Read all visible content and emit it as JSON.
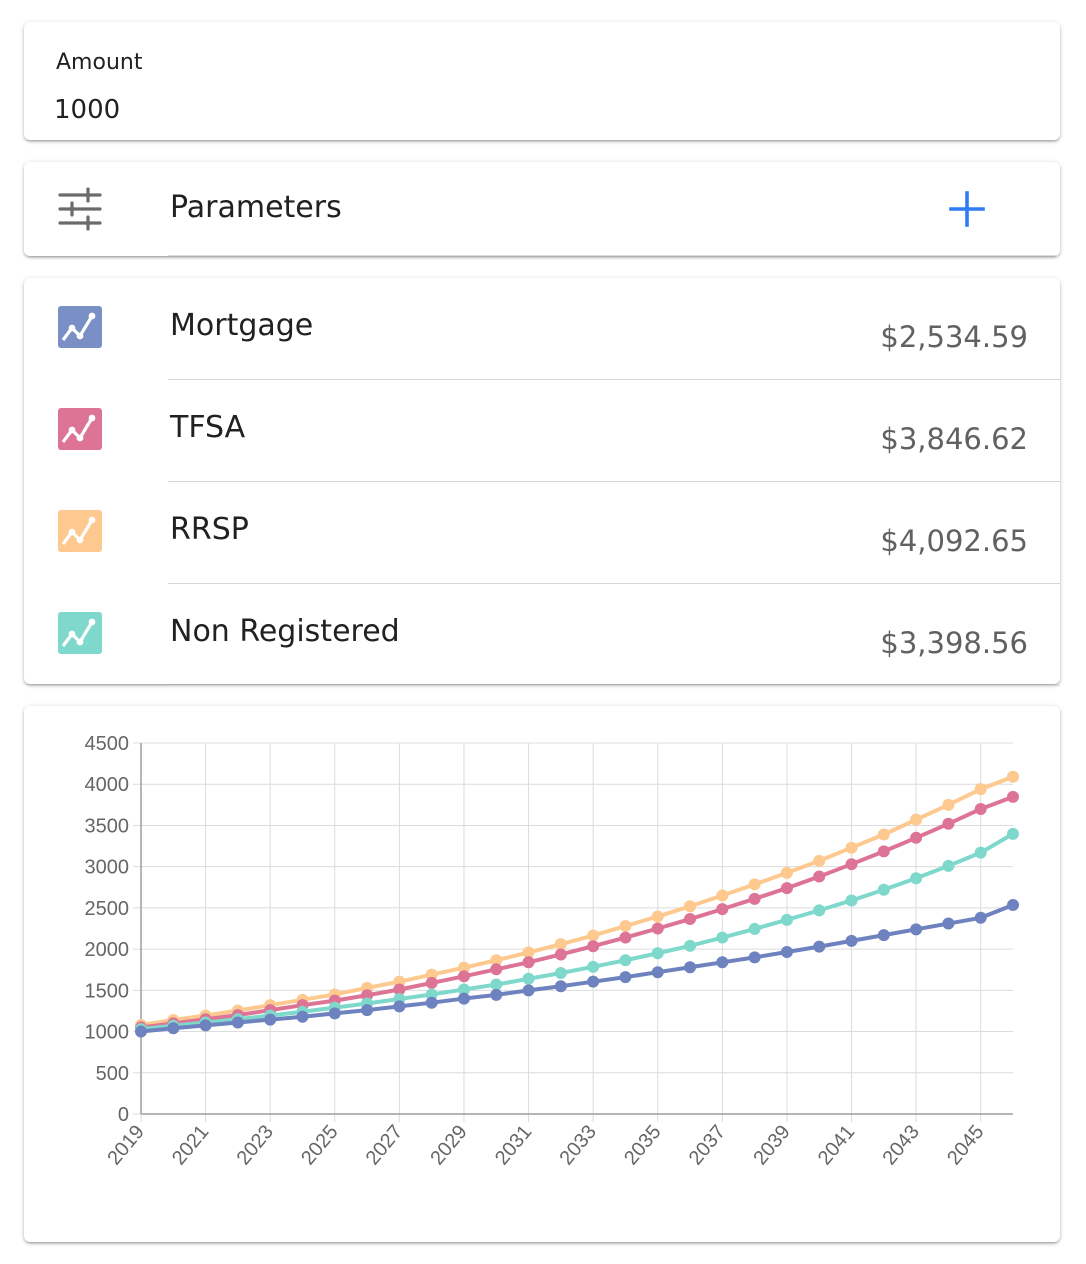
{
  "amount": {
    "label": "Amount",
    "value": "1000"
  },
  "parameters": {
    "label": "Parameters",
    "icon": "tune-icon",
    "action_icon": "plus-icon"
  },
  "accounts": [
    {
      "name": "Mortgage",
      "value": "$2,534.59",
      "color": "#7B8FC7",
      "icon": "chart-line-icon"
    },
    {
      "name": "TFSA",
      "value": "$3,846.62",
      "color": "#DD7395",
      "icon": "chart-line-icon"
    },
    {
      "name": "RRSP",
      "value": "$4,092.65",
      "color": "#FDC98E",
      "icon": "chart-line-icon"
    },
    {
      "name": "Non Registered",
      "value": "$3,398.56",
      "color": "#7ED8CB",
      "icon": "chart-line-icon"
    }
  ],
  "chart_data": {
    "type": "line",
    "x": [
      2019,
      2020,
      2021,
      2022,
      2023,
      2024,
      2025,
      2026,
      2027,
      2028,
      2029,
      2030,
      2031,
      2032,
      2033,
      2034,
      2035,
      2036,
      2037,
      2038,
      2039,
      2040,
      2041,
      2042,
      2043,
      2044,
      2045,
      2046
    ],
    "x_tick_labels": [
      "2019",
      "2021",
      "2023",
      "2025",
      "2027",
      "2029",
      "2031",
      "2033",
      "2035",
      "2037",
      "2039",
      "2041",
      "2043",
      "2045"
    ],
    "y_tick_labels": [
      "0",
      "500",
      "1000",
      "1500",
      "2000",
      "2500",
      "3000",
      "3500",
      "4000",
      "4500"
    ],
    "ylim": [
      0,
      4500
    ],
    "grid": true,
    "legend": "none",
    "series": [
      {
        "name": "RRSP",
        "color": "#FDC98E",
        "values": [
          1080,
          1140,
          1195,
          1255,
          1320,
          1385,
          1450,
          1530,
          1605,
          1690,
          1775,
          1865,
          1960,
          2060,
          2165,
          2280,
          2395,
          2520,
          2650,
          2785,
          2925,
          3070,
          3230,
          3390,
          3570,
          3750,
          3940,
          4090
        ]
      },
      {
        "name": "TFSA",
        "color": "#DD7395",
        "values": [
          1050,
          1100,
          1150,
          1200,
          1260,
          1320,
          1375,
          1440,
          1510,
          1590,
          1670,
          1755,
          1840,
          1935,
          2035,
          2140,
          2250,
          2365,
          2485,
          2610,
          2740,
          2880,
          3030,
          3185,
          3350,
          3520,
          3700,
          3846
        ]
      },
      {
        "name": "Non Registered",
        "color": "#7ED8CB",
        "values": [
          1030,
          1070,
          1110,
          1150,
          1195,
          1240,
          1290,
          1340,
          1395,
          1450,
          1510,
          1570,
          1640,
          1710,
          1785,
          1865,
          1950,
          2040,
          2140,
          2245,
          2355,
          2470,
          2590,
          2720,
          2860,
          3010,
          3170,
          3398
        ]
      },
      {
        "name": "Mortgage",
        "color": "#6E82BF",
        "values": [
          1000,
          1040,
          1075,
          1110,
          1145,
          1180,
          1220,
          1260,
          1305,
          1350,
          1400,
          1445,
          1500,
          1550,
          1605,
          1660,
          1720,
          1780,
          1840,
          1900,
          1965,
          2030,
          2100,
          2170,
          2240,
          2310,
          2380,
          2535
        ]
      }
    ]
  }
}
